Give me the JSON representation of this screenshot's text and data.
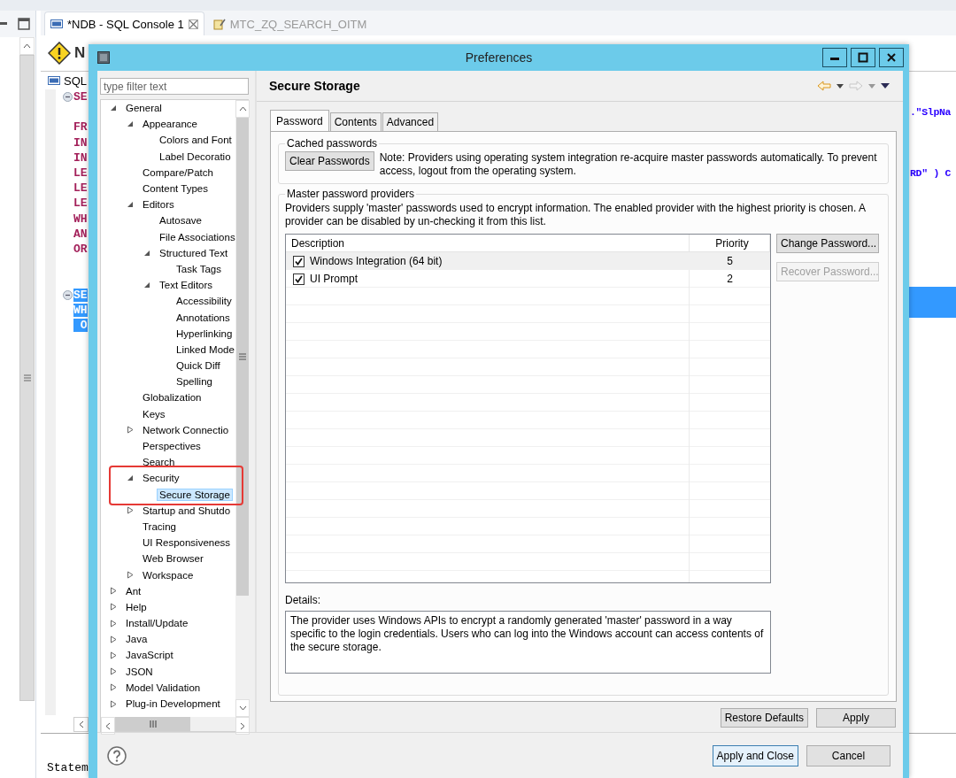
{
  "ide": {
    "view_tabs": [
      {
        "label": "*NDB - SQL Console 1",
        "selected": true,
        "kind": "sql"
      },
      {
        "label": "MTC_ZQ_SEARCH_OITM",
        "selected": false,
        "kind": "procedure"
      }
    ],
    "editor": {
      "heading": "N",
      "sql_label": "SQL",
      "lines": [
        {
          "start": "SE",
          "fold": true,
          "selected": false
        },
        {
          "end": ".\"SlpNa",
          "selected": false
        },
        {
          "start": "FR",
          "selected": false
        },
        {
          "start": "IN",
          "selected": false
        },
        {
          "start": "IN",
          "selected": false
        },
        {
          "start": "LE",
          "end": "RD\" ) C",
          "selected": false
        },
        {
          "start": "LE",
          "selected": false
        },
        {
          "start": "LE",
          "selected": false
        },
        {
          "start": "WH",
          "selected": false
        },
        {
          "start": "AN",
          "selected": false
        },
        {
          "start": "OR",
          "selected": false
        },
        {
          "selected": false
        },
        {
          "selected": false
        },
        {
          "start": "SE",
          "fold": true,
          "selected": true,
          "selected_to_edge": true
        },
        {
          "start": "WH",
          "selected": true,
          "selected_to_edge": true
        },
        {
          "start": " O",
          "selected": true,
          "selected_to_edge": false
        }
      ],
      "console_text": "Statem"
    }
  },
  "dialog": {
    "title": "Preferences",
    "filter": {
      "placeholder": "type filter text"
    },
    "tree": [
      {
        "label": "General",
        "selected": false,
        "expanded": true,
        "children": [
          {
            "label": "Appearance",
            "selected": false,
            "expanded": true,
            "children": [
              {
                "label": "Colors and Font",
                "selected": false
              },
              {
                "label": "Label Decoratio",
                "selected": false
              }
            ]
          },
          {
            "label": "Compare/Patch",
            "selected": false
          },
          {
            "label": "Content Types",
            "selected": false
          },
          {
            "label": "Editors",
            "selected": false,
            "expanded": true,
            "children": [
              {
                "label": "Autosave",
                "selected": false
              },
              {
                "label": "File Associations",
                "selected": false
              },
              {
                "label": "Structured Text",
                "selected": false,
                "expanded": true,
                "children": [
                  {
                    "label": "Task Tags",
                    "selected": false
                  }
                ]
              },
              {
                "label": "Text Editors",
                "selected": false,
                "expanded": true,
                "children": [
                  {
                    "label": "Accessibility",
                    "selected": false
                  },
                  {
                    "label": "Annotations",
                    "selected": false
                  },
                  {
                    "label": "Hyperlinking",
                    "selected": false
                  },
                  {
                    "label": "Linked Mode",
                    "selected": false
                  },
                  {
                    "label": "Quick Diff",
                    "selected": false
                  },
                  {
                    "label": "Spelling",
                    "selected": false
                  }
                ]
              }
            ]
          },
          {
            "label": "Globalization",
            "selected": false
          },
          {
            "label": "Keys",
            "selected": false
          },
          {
            "label": "Network Connectio",
            "selected": false,
            "expanded": false
          },
          {
            "label": "Perspectives",
            "selected": false
          },
          {
            "label": "Search",
            "selected": false
          },
          {
            "label": "Security",
            "selected": false,
            "expanded": true,
            "framed": true,
            "children": [
              {
                "label": "Secure Storage",
                "selected": true
              }
            ]
          },
          {
            "label": "Startup and Shutdo",
            "selected": false,
            "expanded": false
          },
          {
            "label": "Tracing",
            "selected": false
          },
          {
            "label": "UI Responsiveness",
            "selected": false
          },
          {
            "label": "Web Browser",
            "selected": false
          },
          {
            "label": "Workspace",
            "selected": false,
            "expanded": false
          }
        ]
      },
      {
        "label": "Ant",
        "selected": false,
        "expanded": false
      },
      {
        "label": "Help",
        "selected": false,
        "expanded": false
      },
      {
        "label": "Install/Update",
        "selected": false,
        "expanded": false
      },
      {
        "label": "Java",
        "selected": false,
        "expanded": false
      },
      {
        "label": "JavaScript",
        "selected": false,
        "expanded": false
      },
      {
        "label": "JSON",
        "selected": false,
        "expanded": false
      },
      {
        "label": "Model Validation",
        "selected": false,
        "expanded": false
      },
      {
        "label": "Plug-in Development",
        "selected": false,
        "expanded": false
      }
    ],
    "page_title": "Secure Storage",
    "navigation": {
      "back_enabled": true,
      "forward_enabled": false
    },
    "tabs": [
      {
        "label": "Password",
        "selected": true
      },
      {
        "label": "Contents",
        "selected": false
      },
      {
        "label": "Advanced",
        "selected": false
      }
    ],
    "cached_group": {
      "label": "Cached passwords",
      "button": "Clear Passwords",
      "note": "Note: Providers using operating system integration re-acquire master passwords automatically. To prevent access, logout from the operating system."
    },
    "providers_group": {
      "label": "Master password providers",
      "description": "Providers supply 'master' passwords used to encrypt information. The enabled provider with the highest priority is chosen. A provider can be disabled by un-checking it from this list.",
      "columns": [
        "Description",
        "Priority"
      ],
      "rows": [
        {
          "description": "Windows Integration (64 bit)",
          "priority": "5",
          "checked": true,
          "selected": true
        },
        {
          "description": "UI Prompt",
          "priority": "2",
          "checked": true,
          "selected": false
        }
      ],
      "buttons": [
        {
          "label": "Change Password...",
          "disabled": false
        },
        {
          "label": "Recover Password...",
          "disabled": true
        }
      ],
      "details_label": "Details:",
      "details": "The provider uses Windows APIs to encrypt a randomly generated 'master' password in a way specific to the login credentials. Users who can log into the Windows account can access contents of the secure storage."
    },
    "page_buttons": [
      {
        "label": "Restore Defaults"
      },
      {
        "label": "Apply"
      }
    ],
    "dialog_buttons": [
      {
        "label": "Apply and Close",
        "default": true
      },
      {
        "label": "Cancel",
        "default": false
      }
    ]
  }
}
